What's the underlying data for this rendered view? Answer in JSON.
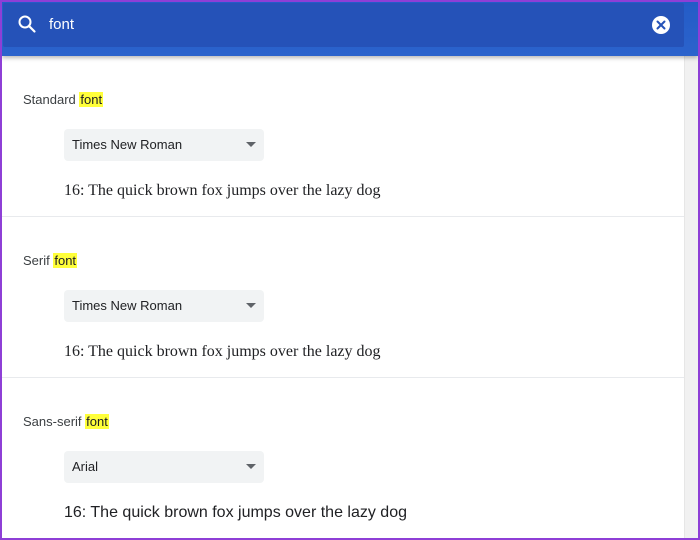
{
  "search": {
    "query": "font",
    "icon": "search-icon",
    "clear_icon": "close-circle-icon"
  },
  "colors": {
    "header": "#2552b8",
    "highlight": "#ffff3a",
    "select_bg": "#f1f3f4"
  },
  "sections": [
    {
      "label_prefix": "Standard",
      "label_match": "font",
      "selected_font": "Times New Roman",
      "sample_text": "16: The quick brown fox jumps over the lazy dog"
    },
    {
      "label_prefix": "Serif",
      "label_match": "font",
      "selected_font": "Times New Roman",
      "sample_text": "16: The quick brown fox jumps over the lazy dog"
    },
    {
      "label_prefix": "Sans-serif",
      "label_match": "font",
      "selected_font": "Arial",
      "sample_text": "16: The quick brown fox jumps over the lazy dog"
    }
  ]
}
